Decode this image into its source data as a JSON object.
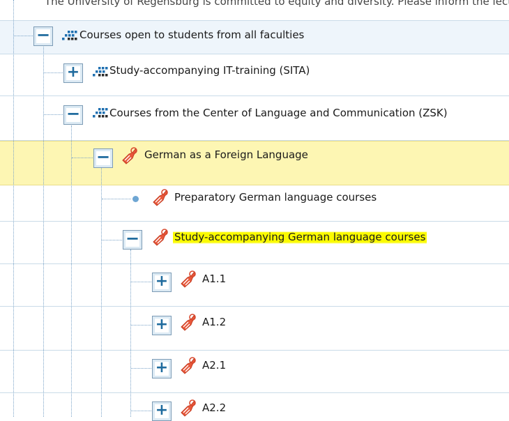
{
  "intro_text": "The University of Regensburg is committed to equity and diversity. Please inform the lect",
  "tree": [
    {
      "label": "Courses open to students from all faculties",
      "toggle": "−",
      "icon": "module-grid-icon"
    },
    {
      "label": "Study-accompanying IT-training (SITA)",
      "toggle": "+",
      "icon": "module-grid-icon"
    },
    {
      "label": "Courses from the Center of Language and Communication (ZSK)",
      "toggle": "−",
      "icon": "module-grid-icon"
    },
    {
      "label": "German as a Foreign Language",
      "toggle": "−",
      "icon": "course-tag-icon"
    },
    {
      "label": "Preparatory German language courses",
      "toggle": "",
      "icon": "course-tag-icon"
    },
    {
      "label": "Study-accompanying German language courses",
      "toggle": "−",
      "icon": "course-tag-icon"
    },
    {
      "label": "A1.1",
      "toggle": "+",
      "icon": "course-tag-icon"
    },
    {
      "label": "A1.2",
      "toggle": "+",
      "icon": "course-tag-icon"
    },
    {
      "label": "A2.1",
      "toggle": "+",
      "icon": "course-tag-icon"
    },
    {
      "label": "A2.2",
      "toggle": "+",
      "icon": "course-tag-icon"
    }
  ],
  "colors": {
    "selected_row": "#fdf6b3",
    "highlight": "#fbfb00",
    "toggle_text": "#1f6b9e"
  }
}
